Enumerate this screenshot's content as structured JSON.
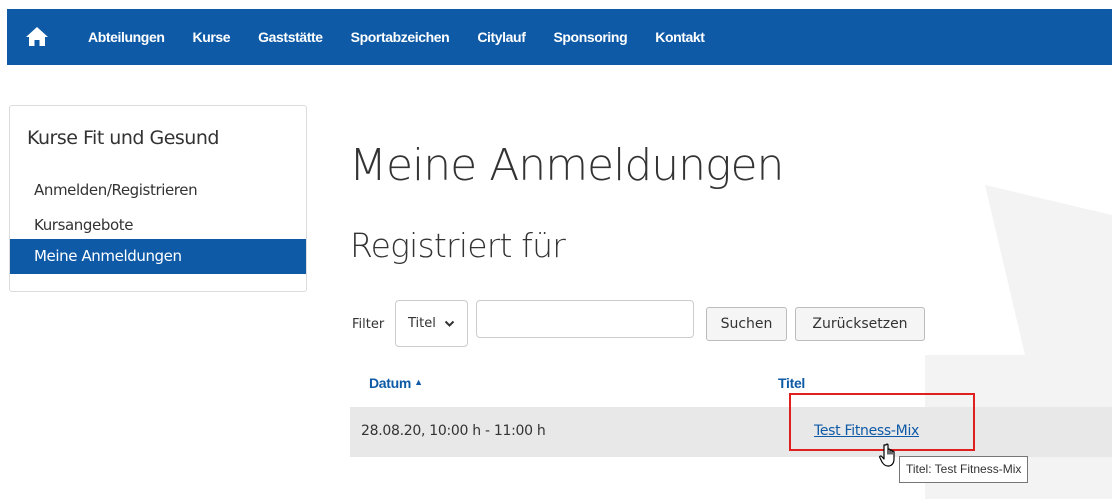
{
  "nav": {
    "home_icon": "home-icon",
    "items": [
      "Abteilungen",
      "Kurse",
      "Gaststätte",
      "Sportabzeichen",
      "Citylauf",
      "Sponsoring",
      "Kontakt"
    ]
  },
  "sidebar": {
    "title": "Kurse Fit und Gesund",
    "items": [
      "Anmelden/Registrieren",
      "Kursangebote",
      "Meine Anmeldungen"
    ],
    "active": "Meine Anmeldungen"
  },
  "page": {
    "title": "Meine Anmeldungen",
    "subtitle": "Registriert für"
  },
  "filter": {
    "label": "Filter",
    "select_value": "Titel",
    "search_value": "",
    "search_button": "Suchen",
    "reset_button": "Zurücksetzen"
  },
  "table": {
    "headers": {
      "datum": "Datum",
      "titel": "Titel"
    },
    "rows": [
      {
        "datum": "28.08.20, 10:00 h - 11:00 h",
        "titel": "Test Fitness-Mix"
      }
    ]
  },
  "tooltip": "Titel: Test Fitness-Mix",
  "colors": {
    "primary": "#0e5aa7",
    "highlight": "#e0201f",
    "row_bg": "#e8e8e8"
  }
}
